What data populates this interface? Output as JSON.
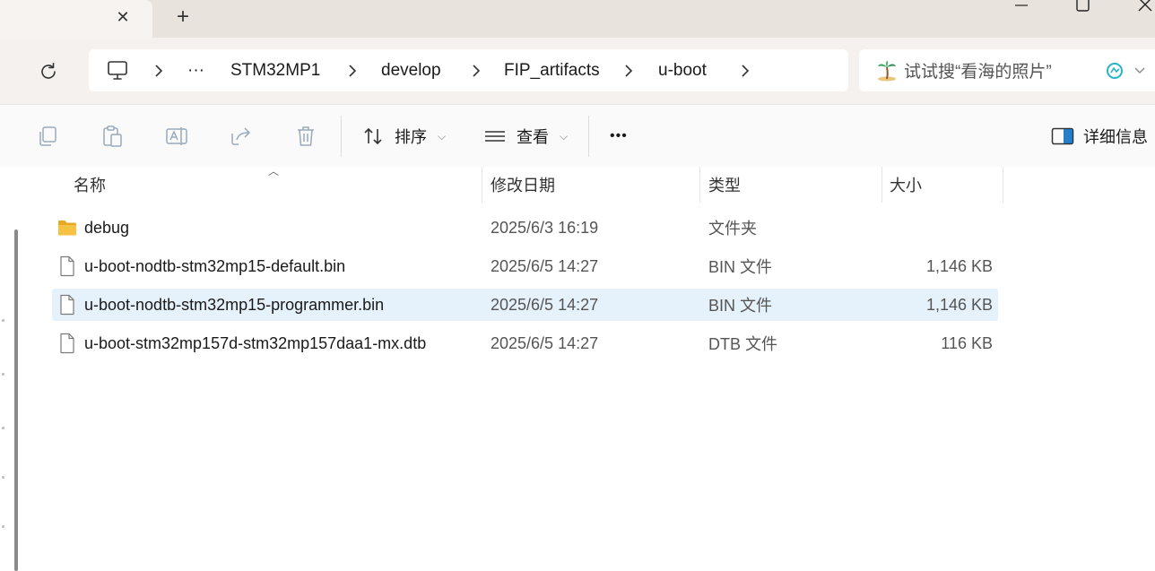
{
  "window": {
    "tab_close_glyph": "✕",
    "new_tab_glyph": "+"
  },
  "breadcrumb": {
    "ellipsis": "···",
    "items": [
      "STM32MP1",
      "develop",
      "FIP_artifacts",
      "u-boot"
    ]
  },
  "search": {
    "placeholder": "试试搜“看海的照片”"
  },
  "toolbar": {
    "sort_label": "排序",
    "view_label": "查看",
    "more_glyph": "•••",
    "details_label": "详细信息"
  },
  "columns": {
    "name": "名称",
    "modified": "修改日期",
    "type": "类型",
    "size": "大小"
  },
  "files": [
    {
      "name": "debug",
      "modified": "2025/6/3 16:19",
      "type": "文件夹",
      "size": "",
      "icon": "folder-icon"
    },
    {
      "name": "u-boot-nodtb-stm32mp15-default.bin",
      "modified": "2025/6/5 14:27",
      "type": "BIN 文件",
      "size": "1,146 KB",
      "icon": "file-icon"
    },
    {
      "name": "u-boot-nodtb-stm32mp15-programmer.bin",
      "modified": "2025/6/5 14:27",
      "type": "BIN 文件",
      "size": "1,146 KB",
      "icon": "file-icon",
      "selected": true
    },
    {
      "name": "u-boot-stm32mp157d-stm32mp157daa1-mx.dtb",
      "modified": "2025/6/5 14:27",
      "type": "DTB 文件",
      "size": "116 KB",
      "icon": "file-icon"
    }
  ],
  "colors": {
    "accent": "#0067c0",
    "selection": "#e5f1fb",
    "folder": "#f5c243"
  }
}
